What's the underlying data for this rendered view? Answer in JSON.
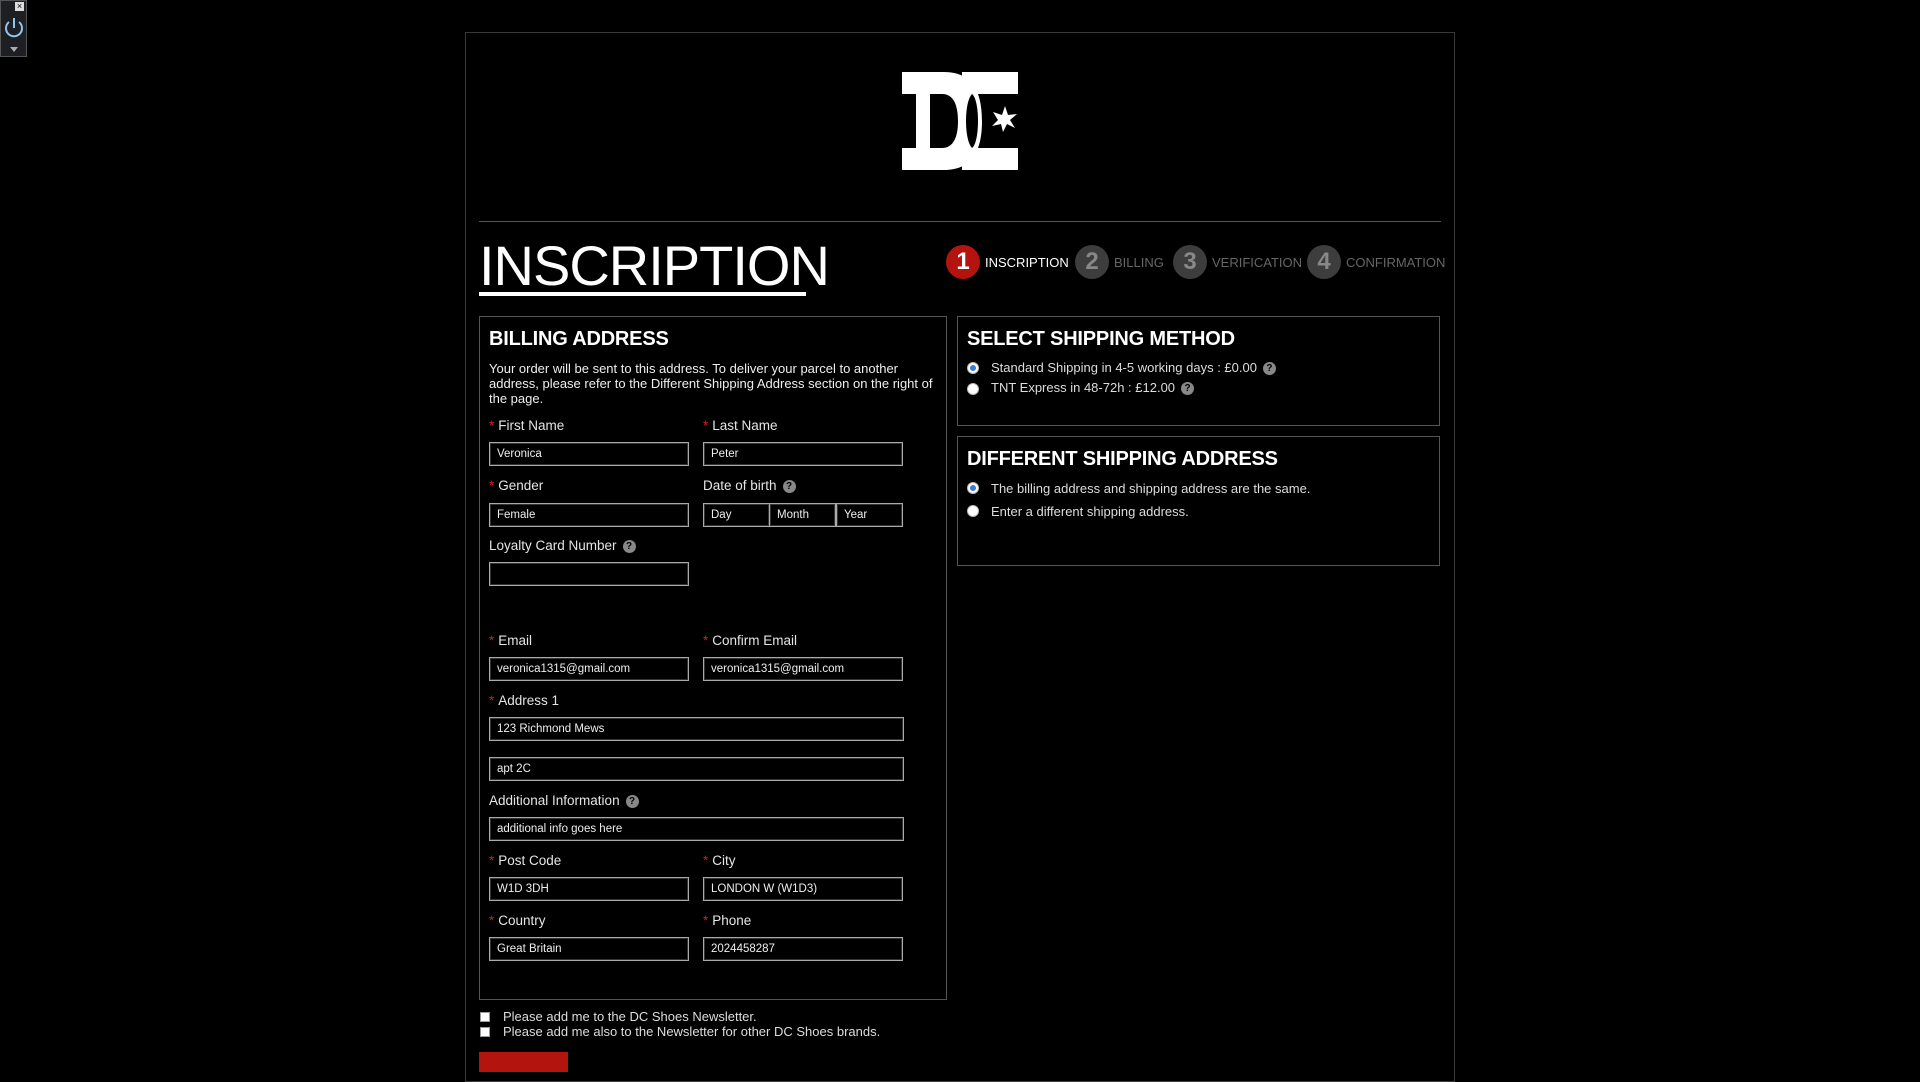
{
  "page": {
    "title": "INSCRIPTION",
    "logo_text": "DC"
  },
  "steps": [
    {
      "num": "1",
      "label": "INSCRIPTION",
      "active": true
    },
    {
      "num": "2",
      "label": "BILLING",
      "active": false
    },
    {
      "num": "3",
      "label": "VERIFICATION",
      "active": false
    },
    {
      "num": "4",
      "label": "CONFIRMATION",
      "active": false
    }
  ],
  "billing": {
    "title": "BILLING ADDRESS",
    "intro": "Your order will be sent to this address. To deliver your parcel to another address, please refer to the Different Shipping Address section on the right of the page.",
    "first_name": {
      "label": "First Name",
      "value": "Veronica"
    },
    "last_name": {
      "label": "Last Name",
      "value": "Peter"
    },
    "gender": {
      "label": "Gender",
      "value": "Female"
    },
    "dob": {
      "label": "Date of birth",
      "day": "Day",
      "month": "Month",
      "year": "Year"
    },
    "loyalty": {
      "label": "Loyalty Card Number",
      "value": ""
    },
    "email": {
      "label": "Email",
      "value": "veronica1315@gmail.com"
    },
    "confirm_email": {
      "label": "Confirm Email",
      "value": "veronica1315@gmail.com"
    },
    "address1": {
      "label": "Address 1",
      "value": "123 Richmond Mews"
    },
    "address2": {
      "value": "apt 2C"
    },
    "additional": {
      "label": "Additional Information",
      "value": "additional info goes here"
    },
    "post_code": {
      "label": "Post Code",
      "value": "W1D 3DH"
    },
    "city": {
      "label": "City",
      "value": "LONDON W (W1D3)"
    },
    "country": {
      "label": "Country",
      "value": "Great Britain"
    },
    "phone": {
      "label": "Phone",
      "value": "2024458287"
    }
  },
  "shipping_method": {
    "title": "SELECT SHIPPING METHOD",
    "options": [
      {
        "label": "Standard Shipping in 4-5 working days : £0.00",
        "selected": true
      },
      {
        "label": "TNT Express in 48-72h : £12.00",
        "selected": false
      }
    ]
  },
  "shipping_address": {
    "title": "DIFFERENT SHIPPING ADDRESS",
    "options": [
      {
        "label": "The billing address and shipping address are the same.",
        "selected": true
      },
      {
        "label": "Enter a different shipping address.",
        "selected": false
      }
    ]
  },
  "newsletter": {
    "dc": "Please add me to the DC Shoes Newsletter.",
    "other": "Please add me also to the Newsletter for other DC Shoes brands."
  },
  "help_glyph": "?",
  "colors": {
    "accent": "#b3140e",
    "required": "#d21f1f",
    "radio_dot": "#3a7bd5"
  }
}
